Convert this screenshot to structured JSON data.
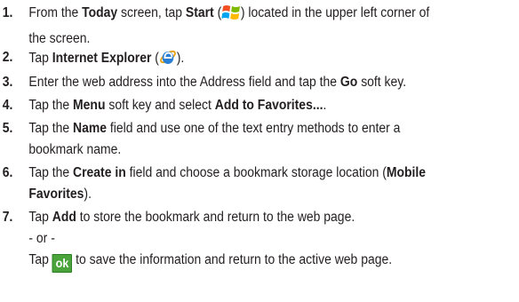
{
  "steps": [
    {
      "number": "1.",
      "segments": {
        "s0": "From the ",
        "s1": "Today",
        "s2": " screen, tap ",
        "s3": "Start",
        "s4": " (",
        "s5": ") located in the upper left corner of",
        "s6": "the screen."
      },
      "icon": "windows-start-flag-icon"
    },
    {
      "number": "2.",
      "segments": {
        "s0": "Tap ",
        "s1": "Internet Explorer",
        "s2": " (",
        "s3": ")."
      },
      "icon": "internet-explorer-icon"
    },
    {
      "number": "3.",
      "segments": {
        "s0": "Enter the web address into the Address field and tap the ",
        "s1": "Go",
        "s2": " soft key."
      }
    },
    {
      "number": "4.",
      "segments": {
        "s0": "Tap the ",
        "s1": "Menu",
        "s2": " soft key and select ",
        "s3": "Add to Favorites...",
        "s4": "."
      }
    },
    {
      "number": "5.",
      "segments": {
        "s0": "Tap the ",
        "s1": "Name",
        "s2": " field and use one of the text entry methods to enter a",
        "s3": "bookmark name."
      }
    },
    {
      "number": "6.",
      "segments": {
        "s0": "Tap the ",
        "s1": "Create in",
        "s2": " field and choose a bookmark storage location (",
        "s3": "Mobile",
        "s4": "Favorites",
        "s5": ")."
      }
    },
    {
      "number": "7.",
      "segments": {
        "s0": "Tap ",
        "s1": "Add",
        "s2": " to store the bookmark and return to the web page.",
        "or": "- or -",
        "s3": "Tap ",
        "ok": "ok",
        "s4": " to save the information and return to the active web page."
      },
      "icon": "ok-button-icon"
    }
  ],
  "colors": {
    "text": "#231f20",
    "ok_button": "#4aa33b"
  }
}
